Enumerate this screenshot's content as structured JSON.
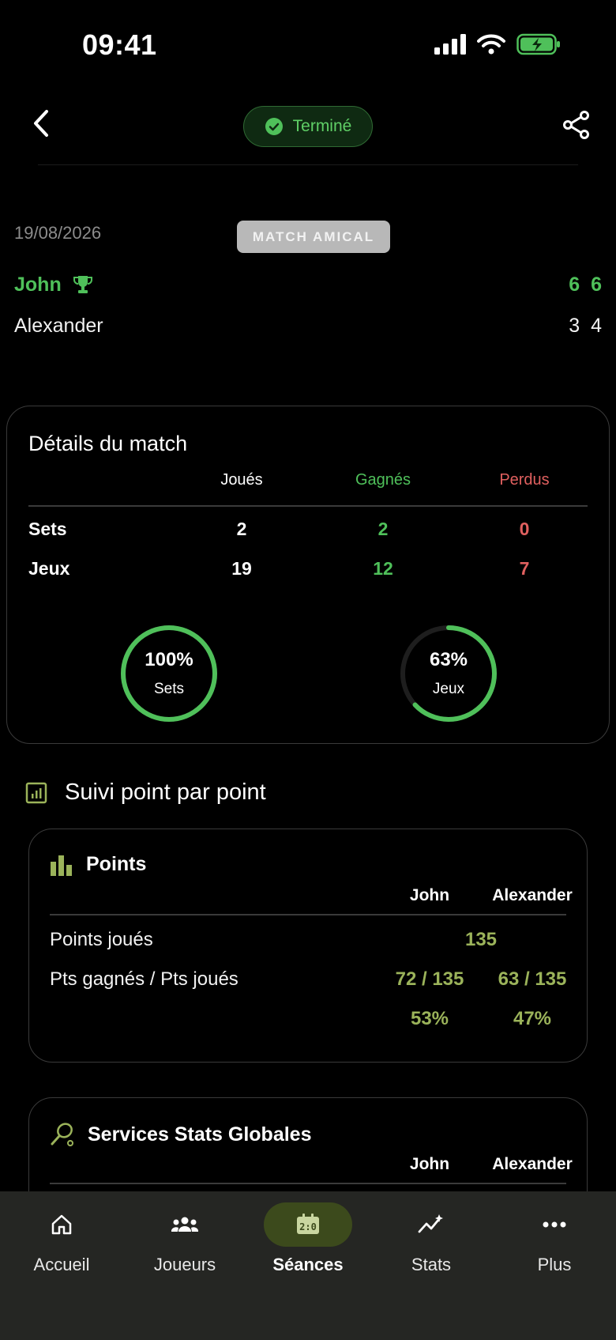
{
  "status_bar": {
    "time": "09:41"
  },
  "header": {
    "status_label": "Terminé"
  },
  "match": {
    "date": "19/08/2026",
    "type": "MATCH AMICAL",
    "players": [
      {
        "name": "John",
        "sets": [
          "6",
          "6"
        ],
        "winner": true
      },
      {
        "name": "Alexander",
        "sets": [
          "3",
          "4"
        ],
        "winner": false
      }
    ]
  },
  "details": {
    "title": "Détails du match",
    "headers": {
      "played": "Joués",
      "won": "Gagnés",
      "lost": "Perdus"
    },
    "rows": [
      {
        "label": "Sets",
        "played": "2",
        "won": "2",
        "lost": "0"
      },
      {
        "label": "Jeux",
        "played": "19",
        "won": "12",
        "lost": "7"
      }
    ],
    "rings": [
      {
        "percent_label": "100%",
        "label": "Sets",
        "value": 1.0
      },
      {
        "percent_label": "63%",
        "label": "Jeux",
        "value": 0.63
      }
    ]
  },
  "tracking": {
    "title": "Suivi point par point"
  },
  "points": {
    "title": "Points",
    "players": [
      "John",
      "Alexander"
    ],
    "played_label": "Points joués",
    "played_value": "135",
    "won_label": "Pts gagnés / Pts joués",
    "won_values": [
      "72 / 135",
      "63 / 135"
    ],
    "percents": [
      "53%",
      "47%"
    ]
  },
  "services": {
    "title": "Services Stats Globales",
    "players": [
      "John",
      "Alexander"
    ]
  },
  "tabs": [
    {
      "label": "Accueil",
      "icon": "home-icon",
      "active": false
    },
    {
      "label": "Joueurs",
      "icon": "players-icon",
      "active": false
    },
    {
      "label": "Séances",
      "icon": "scoreboard-icon",
      "active": true
    },
    {
      "label": "Stats",
      "icon": "stats-icon",
      "active": false
    },
    {
      "label": "Plus",
      "icon": "more-icon",
      "active": false
    }
  ],
  "colors": {
    "accent_green": "#4fc05a",
    "loss_red": "#e0605f",
    "olive": "#9bb35a",
    "active_tab": "#3c4a1c"
  }
}
